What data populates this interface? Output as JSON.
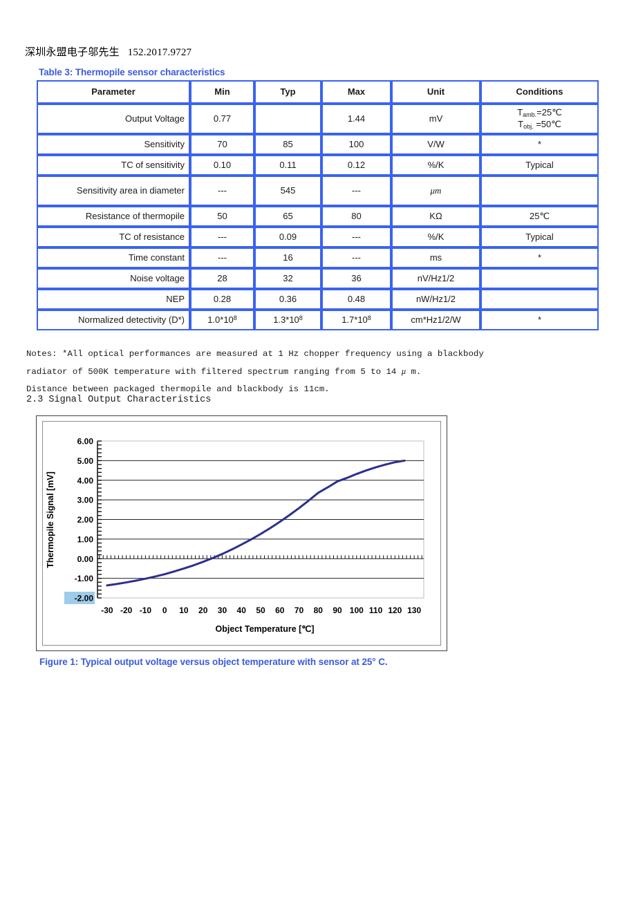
{
  "header": {
    "company_line": "深圳永盟电子邬先生   152.2017.9727"
  },
  "table": {
    "caption": "Table 3: Thermopile sensor characteristics",
    "columns": [
      "Parameter",
      "Min",
      "Typ",
      "Max",
      "Unit",
      "Conditions"
    ],
    "rows": [
      {
        "parameter": "Output Voltage",
        "min": "0.77",
        "typ": "",
        "max": "1.44",
        "unit": "mV",
        "conditions_line1_prefix": "T",
        "conditions_line1_sub": "amb.",
        "conditions_line1_suffix": "=25℃",
        "conditions_line2_prefix": "T",
        "conditions_line2_sub": "obj.",
        "conditions_line2_suffix": " =50℃"
      },
      {
        "parameter": "Sensitivity",
        "min": "70",
        "typ": "85",
        "max": "100",
        "unit": "V/W",
        "conditions": "*"
      },
      {
        "parameter": "TC of sensitivity",
        "min": "0.10",
        "typ": "0.11",
        "max": "0.12",
        "unit": "%/K",
        "conditions": "Typical"
      },
      {
        "parameter": "Sensitivity area in diameter",
        "min": "---",
        "typ": "545",
        "max": "---",
        "unit": "μm",
        "conditions": ""
      },
      {
        "parameter": "Resistance of thermopile",
        "min": "50",
        "typ": "65",
        "max": "80",
        "unit": "KΩ",
        "conditions": "25℃"
      },
      {
        "parameter": "TC of resistance",
        "min": "---",
        "typ": "0.09",
        "max": "---",
        "unit": "%/K",
        "conditions": "Typical"
      },
      {
        "parameter": "Time constant",
        "min": "---",
        "typ": "16",
        "max": "---",
        "unit": "ms",
        "conditions": "*"
      },
      {
        "parameter": "Noise voltage",
        "min": "28",
        "typ": "32",
        "max": "36",
        "unit": "nV/Hz1/2",
        "conditions": ""
      },
      {
        "parameter": "NEP",
        "min": "0.28",
        "typ": "0.36",
        "max": "0.48",
        "unit": "nW/Hz1/2",
        "conditions": ""
      },
      {
        "parameter": "Normalized detectivity (D*)",
        "min_mantissa": "1.0*10",
        "min_exp": "8",
        "typ_mantissa": "1.3*10",
        "typ_exp": "8",
        "max_mantissa": "1.7*10",
        "max_exp": "8",
        "unit": "cm*Hz1/2/W",
        "conditions": "*"
      }
    ],
    "border_color": "#3a63f0"
  },
  "notes": {
    "line1": "Notes: *All optical performances are measured at 1 Hz chopper frequency using a blackbody",
    "line2_a": "radiator of 500K temperature with filtered spectrum ranging from 5 to 14 ",
    "line2_mu": "μ",
    "line2_b": " m.",
    "line3": "Distance between packaged thermopile and blackbody is 11cm."
  },
  "section_heading": "2.3 Signal Output Characteristics",
  "figure": {
    "caption": "Figure 1: Typical output voltage versus object temperature with sensor at 25° C."
  },
  "chart_data": {
    "type": "line",
    "title": "",
    "xlabel": "Object Temperature [℃]",
    "ylabel": "Thermopile Signal [mV]",
    "xlim": [
      -35,
      135
    ],
    "ylim": [
      -2.0,
      6.0
    ],
    "xticks": [
      -30,
      -20,
      -10,
      0,
      10,
      20,
      30,
      40,
      50,
      60,
      70,
      80,
      90,
      100,
      110,
      120,
      130
    ],
    "xtick_labels": [
      "-30",
      "-20",
      "-10",
      "0",
      "10",
      "20",
      "30",
      "40",
      "50",
      "60",
      "70",
      "80",
      "90",
      "100",
      "110",
      "120",
      "130"
    ],
    "yticks": [
      -2.0,
      -1.0,
      0.0,
      1.0,
      2.0,
      3.0,
      4.0,
      5.0,
      6.0
    ],
    "ytick_labels": [
      "-2.00",
      "-1.00",
      "0.00",
      "1.00",
      "2.00",
      "3.00",
      "4.00",
      "5.00",
      "6.00"
    ],
    "highlighted_ytick_label": "-2.00",
    "highlight_color": "#9ecbe8",
    "grid": "horizontal",
    "line_color": "#2b2f8f",
    "line_width": 3,
    "series": [
      {
        "name": "Typical output voltage",
        "x": [
          -30,
          -25,
          -20,
          -15,
          -10,
          -5,
          0,
          5,
          10,
          15,
          20,
          25,
          30,
          35,
          40,
          45,
          50,
          55,
          60,
          65,
          70,
          75,
          80,
          85,
          90,
          95,
          100,
          105,
          110,
          115,
          120,
          125
        ],
        "y": [
          -1.36,
          -1.29,
          -1.21,
          -1.12,
          -1.02,
          -0.91,
          -0.79,
          -0.65,
          -0.5,
          -0.34,
          -0.16,
          0.03,
          0.24,
          0.47,
          0.72,
          0.98,
          1.26,
          1.56,
          1.88,
          2.22,
          2.58,
          2.96,
          3.36,
          3.64,
          3.94,
          4.12,
          4.32,
          4.5,
          4.66,
          4.8,
          4.92,
          5.0
        ]
      }
    ]
  }
}
